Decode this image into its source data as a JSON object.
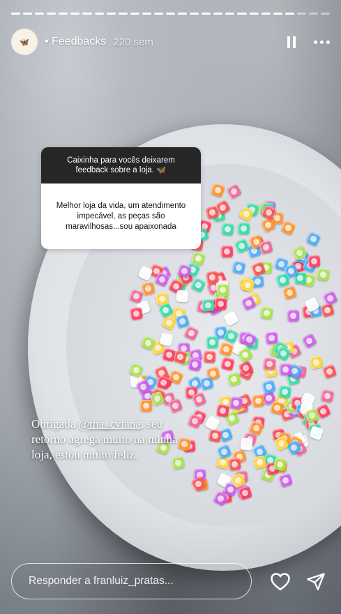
{
  "story": {
    "progress_total": 27,
    "progress_done": 24,
    "account_name": "• Feedbacks",
    "time_ago": "220 sem"
  },
  "question_sticker": {
    "prompt": "Caixinha para vocês deixarem feedback sobre a loja. 🦋",
    "answer": "Melhor loja da vida, um atendimento impecável, as peças são maravilhosas...sou apaixonada"
  },
  "caption": {
    "before_mention": "Obrigada ",
    "mention": "@tha_cviana",
    "after_mention": ", seu retorno agrega muito na minha loja, estou muito feliz."
  },
  "footer": {
    "reply_placeholder": "Responder a franluiz_pratas..."
  },
  "colors": {
    "bead_palette": [
      "#ff3b5c",
      "#ffd43b",
      "#38d9a9",
      "#4dabf7",
      "#cc5de8",
      "#ff922b",
      "#f06595",
      "#a9e34b",
      "#ffffff",
      "#fa5252"
    ]
  },
  "icons": {
    "pause": "pause-icon",
    "more": "more-options-icon",
    "like": "heart-icon",
    "share": "send-icon"
  }
}
